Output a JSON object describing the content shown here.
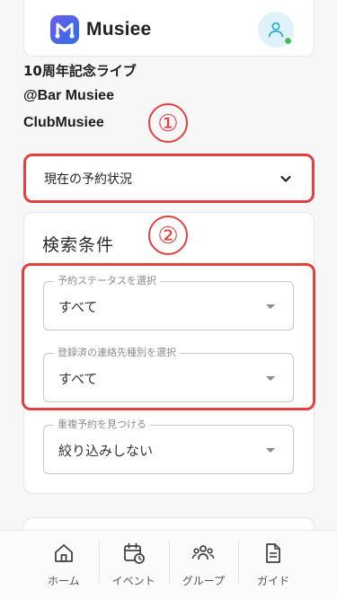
{
  "header": {
    "app_name": "Musiee",
    "logo_icon": "musiee-logo-icon",
    "avatar_icon": "user-icon",
    "online_status_color": "#3cc44c"
  },
  "event_info": {
    "title": "10周年記念ライブ",
    "venue": "@Bar Musiee",
    "organizer": "ClubMusiee"
  },
  "annotations": {
    "marker_1": "①",
    "marker_2": "②",
    "highlight_color": "#e3403f"
  },
  "reservation_status": {
    "label": "現在の予約状況",
    "toggle_icon": "chevron-down-icon"
  },
  "search": {
    "title": "検索条件",
    "fields": [
      {
        "legend": "予約ステータスを選択",
        "value": "すべて"
      },
      {
        "legend": "登録済の連絡先種別を選択",
        "value": "すべて"
      },
      {
        "legend": "重複予約を見つける",
        "value": "絞り込みしない"
      }
    ]
  },
  "bottom_nav": {
    "items": [
      {
        "label": "ホーム",
        "icon": "home-icon"
      },
      {
        "label": "イベント",
        "icon": "calendar-clock-icon"
      },
      {
        "label": "グループ",
        "icon": "group-icon"
      },
      {
        "label": "ガイド",
        "icon": "document-icon"
      }
    ]
  }
}
